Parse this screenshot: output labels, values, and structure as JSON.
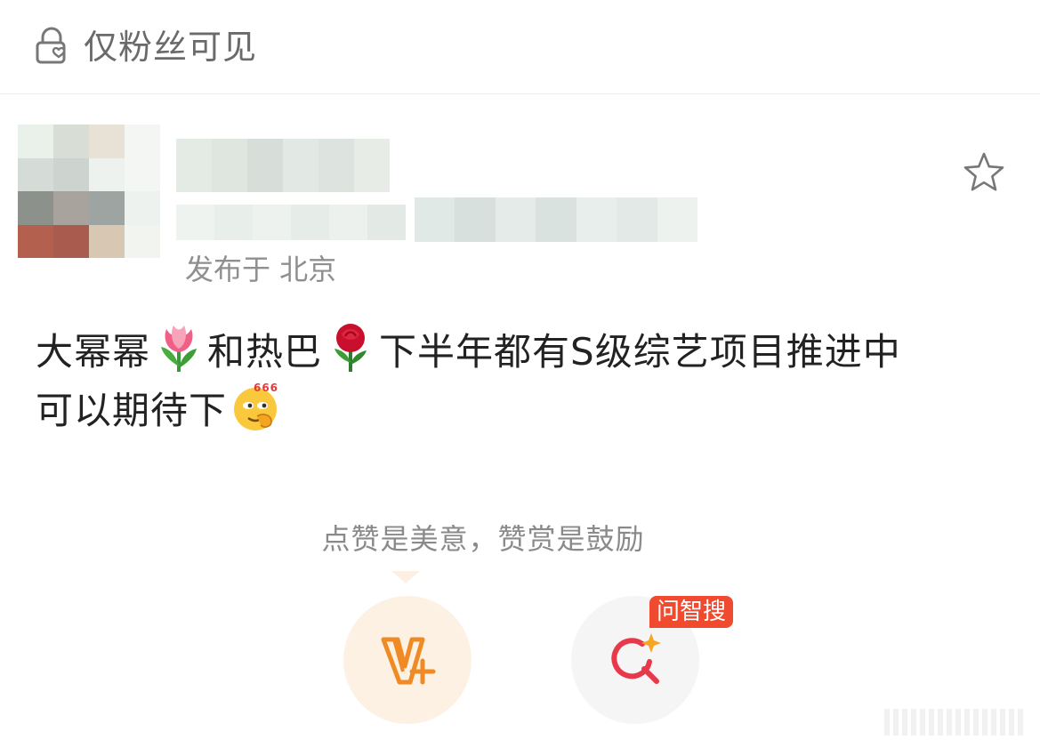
{
  "topbar": {
    "visibility_label": "仅粉丝可见",
    "icon": "lock-heart-icon"
  },
  "post": {
    "meta": "发布于 北京",
    "text_part1": "大幂幂",
    "text_part2": "和热巴",
    "text_part3": "下半年都有S级综艺项目推进中",
    "text_part4": "可以期待下",
    "emoji_1": "tulip-emoji",
    "emoji_2": "rose-emoji",
    "emoji_3": "666-emoji",
    "emoji_3_text": "666",
    "favorite_icon": "star-icon"
  },
  "actions": {
    "reward_tip": "点赞是美意，赞赏是鼓励",
    "reward_icon": "v-plus-icon",
    "search_icon": "ai-search-icon",
    "search_badge": "问智搜",
    "accent_color": "#f08a24",
    "badge_color": "#f04a2f"
  }
}
